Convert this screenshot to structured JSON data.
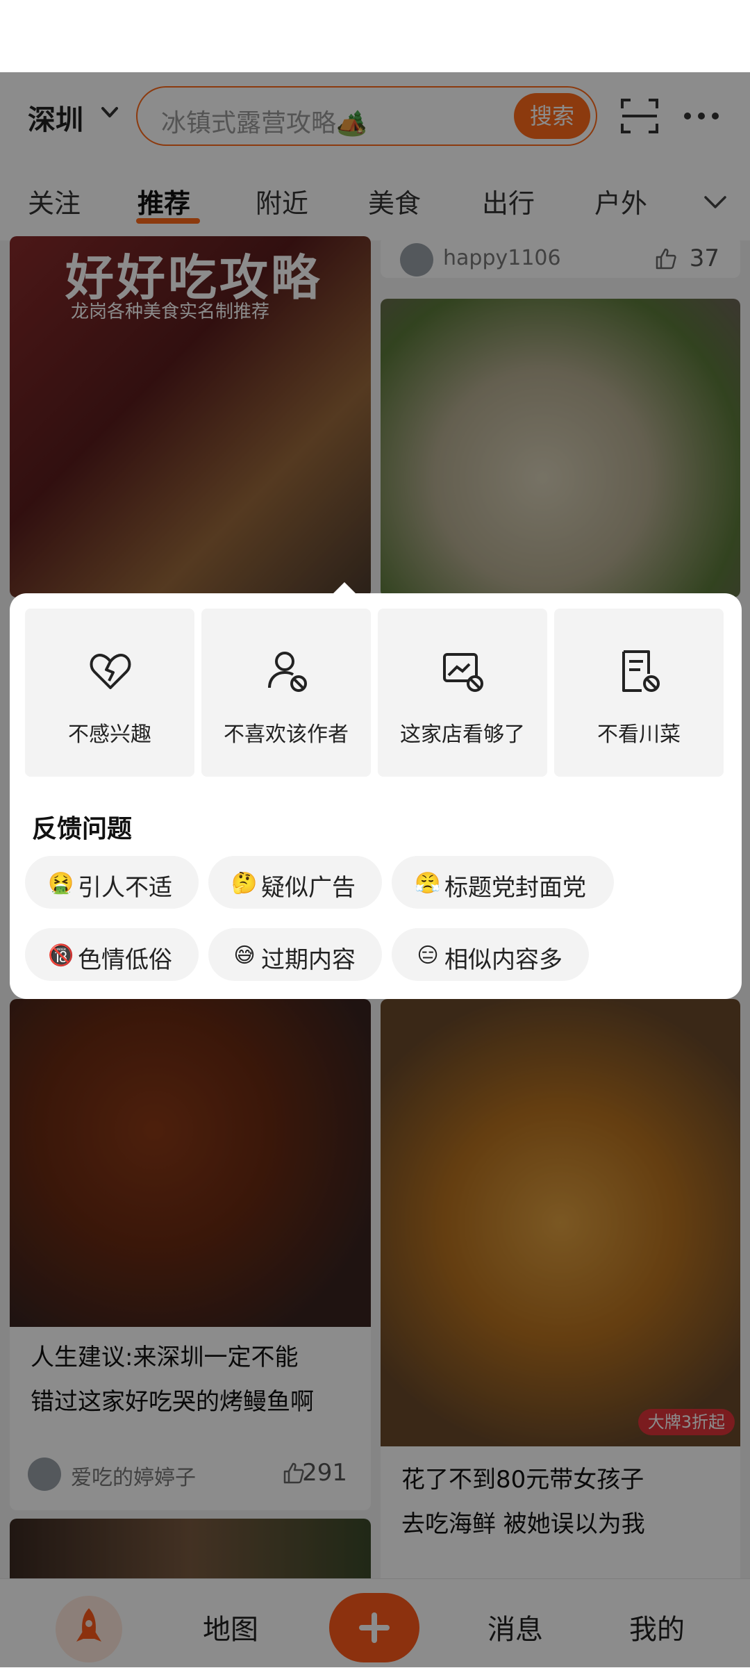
{
  "header": {
    "city": "深圳",
    "search_placeholder": "冰镇式露营攻略🏕️",
    "search_button": "搜索"
  },
  "tabs": [
    {
      "label": "关注"
    },
    {
      "label": "推荐",
      "active": true
    },
    {
      "label": "附近"
    },
    {
      "label": "美食"
    },
    {
      "label": "出行"
    },
    {
      "label": "户外"
    }
  ],
  "feed": {
    "card1": {
      "overlay_title": "好好吃攻略",
      "overlay_sub": "龙岗各种美食实名制推荐"
    },
    "card2_meta": {
      "author": "happy1106",
      "likes": "37"
    },
    "card3": {
      "title_line1": "人生建议:来深圳一定不能",
      "title_line2": "错过这家好吃哭的烤鳗鱼啊",
      "author": "爱吃的婷婷子",
      "likes": "291"
    },
    "card4": {
      "title_line1": "花了不到80元带女孩子",
      "title_line2": "去吃海鲜 被她误以为我",
      "badge": "大牌3折起"
    }
  },
  "feedback": {
    "options": [
      {
        "label": "不感兴趣",
        "icon": "broken-heart-icon"
      },
      {
        "label": "不喜欢该作者",
        "icon": "user-block-icon"
      },
      {
        "label": "这家店看够了",
        "icon": "store-block-icon"
      },
      {
        "label": "不看川菜",
        "icon": "document-block-icon"
      }
    ],
    "title": "反馈问题",
    "chips": [
      {
        "emoji": "🤮",
        "label": "引人不适"
      },
      {
        "emoji": "🤔",
        "label": "疑似广告"
      },
      {
        "emoji": "😤",
        "label": "标题党封面党"
      },
      {
        "emoji": "🔞",
        "label": "色情低俗"
      },
      {
        "emoji": "😅",
        "label": "过期内容"
      },
      {
        "emoji": "😑",
        "label": "相似内容多"
      }
    ]
  },
  "nav": {
    "map": "地图",
    "messages": "消息",
    "mine": "我的"
  },
  "colors": {
    "accent": "#ff6a1a",
    "overlay": "rgba(0,0,0,0.45)"
  }
}
